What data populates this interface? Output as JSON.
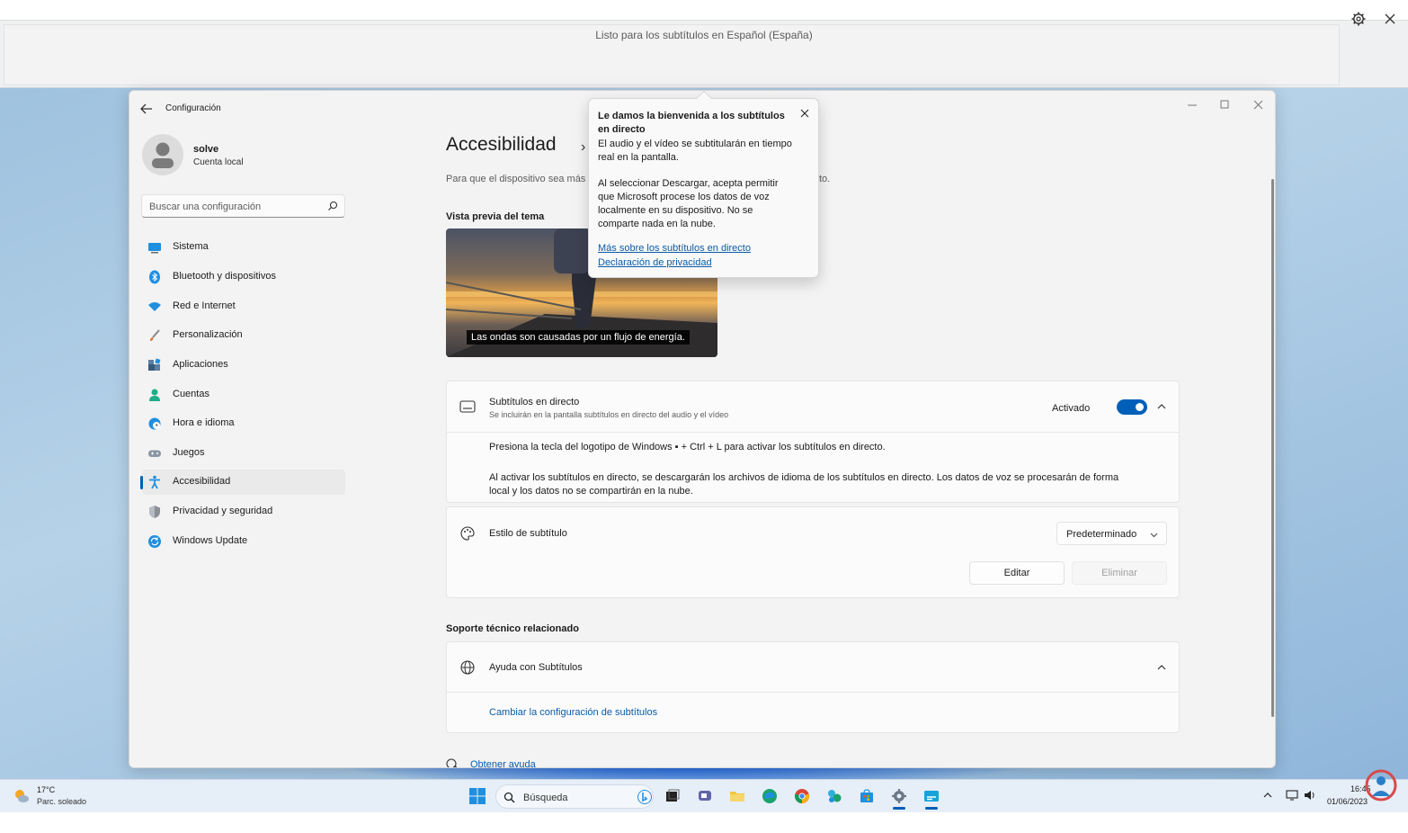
{
  "caption_bar": {
    "status": "Listo para los subtítulos en Español (España)"
  },
  "window": {
    "title": "Configuración"
  },
  "user": {
    "name": "solve",
    "account": "Cuenta local"
  },
  "search": {
    "placeholder": "Buscar una configuración"
  },
  "nav": {
    "items": [
      {
        "label": "Sistema",
        "icon": "monitor-icon"
      },
      {
        "label": "Bluetooth y dispositivos",
        "icon": "bluetooth-icon"
      },
      {
        "label": "Red e Internet",
        "icon": "wifi-icon"
      },
      {
        "label": "Personalización",
        "icon": "brush-icon"
      },
      {
        "label": "Aplicaciones",
        "icon": "apps-icon"
      },
      {
        "label": "Cuentas",
        "icon": "person-icon"
      },
      {
        "label": "Hora e idioma",
        "icon": "globe-clock-icon"
      },
      {
        "label": "Juegos",
        "icon": "gamepad-icon"
      },
      {
        "label": "Accesibilidad",
        "icon": "accessibility-icon",
        "active": true
      },
      {
        "label": "Privacidad y seguridad",
        "icon": "shield-icon"
      },
      {
        "label": "Windows Update",
        "icon": "update-icon"
      }
    ]
  },
  "content": {
    "title": "Accesibilidad",
    "description_left": "Para que el dispositivo sea más",
    "description_right": "to.",
    "preview_heading": "Vista previa del tema",
    "preview_caption": "Las ondas son causadas por un flujo de energía.",
    "live_captions": {
      "title": "Subtítulos en directo",
      "subtitle": "Se incluirán en la pantalla subtítulos en directo del audio y el vídeo",
      "state": "Activado",
      "hint": "Presiona la tecla del logotipo de Windows ▪ + Ctrl + L para activar los subtítulos en directo.",
      "info_line1": "Al activar los subtítulos en directo, se descargarán los archivos de idioma de los subtítulos en directo. Los datos de voz se procesarán de forma",
      "info_line2": "local y los datos no se compartirán en la nube."
    },
    "caption_style": {
      "title": "Estilo de subtítulo",
      "selected": "Predeterminado",
      "edit_label": "Editar",
      "delete_label": "Eliminar"
    },
    "support_heading": "Soporte técnico relacionado",
    "help": {
      "title": "Ayuda con Subtítulos",
      "link": "Cambiar la configuración de subtítulos"
    },
    "get_help": "Obtener ayuda"
  },
  "popup": {
    "title": "Le damos la bienvenida a los subtítulos en directo",
    "p1": "El audio y el vídeo se subtitularán en tiempo real en la pantalla.",
    "p2": "Al seleccionar Descargar, acepta permitir que Microsoft procese los datos de voz localmente en su dispositivo. No se comparte nada en la nube.",
    "link1": "Más sobre los subtítulos en directo",
    "link2": "Declaración de privacidad"
  },
  "taskbar": {
    "weather_temp": "17°C",
    "weather_desc": "Parc. soleado",
    "search_label": "Búsqueda",
    "clock_time": "16:45",
    "clock_date": "01/06/2023"
  },
  "colors": {
    "accent": "#005fb8",
    "link": "#0a5ba8"
  }
}
